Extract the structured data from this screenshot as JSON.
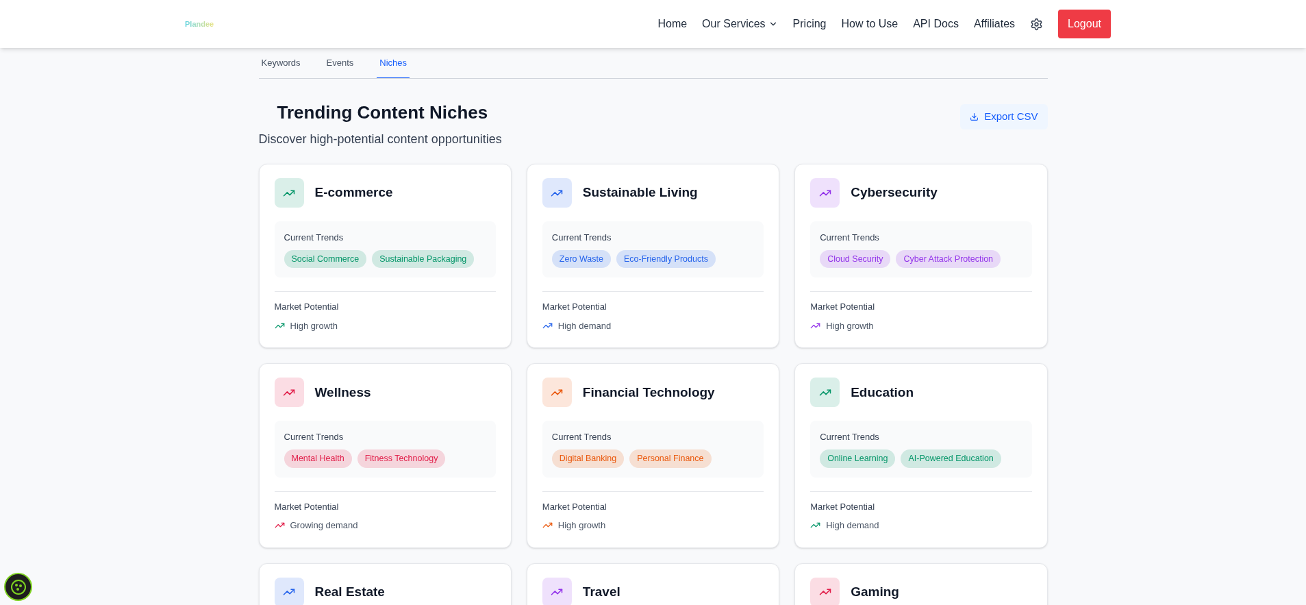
{
  "header": {
    "logo": "Plandee",
    "nav": [
      {
        "label": "Home",
        "kind": "link"
      },
      {
        "label": "Our Services",
        "kind": "dropdown"
      },
      {
        "label": "Pricing",
        "kind": "link"
      },
      {
        "label": "How to Use",
        "kind": "link"
      },
      {
        "label": "API Docs",
        "kind": "link"
      },
      {
        "label": "Affiliates",
        "kind": "link"
      }
    ],
    "logout": "Logout"
  },
  "tabs": [
    {
      "label": "Keywords",
      "selected": false
    },
    {
      "label": "Events",
      "selected": false
    },
    {
      "label": "Niches",
      "selected": true
    }
  ],
  "title": "Trending Content Niches",
  "subtitle": "Discover high-potential content opportunities",
  "export": "Export CSV",
  "niches": [
    {
      "name": "E-commerce",
      "color": "#059669",
      "trends_label": "Current Trends",
      "trends": [
        "Social Commerce",
        "Sustainable Packaging"
      ],
      "potential_label": "Market Potential",
      "potential": "High growth"
    },
    {
      "name": "Sustainable Living",
      "color": "#2563eb",
      "trends_label": "Current Trends",
      "trends": [
        "Zero Waste",
        "Eco-Friendly Products"
      ],
      "potential_label": "Market Potential",
      "potential": "High demand"
    },
    {
      "name": "Cybersecurity",
      "color": "#9333ea",
      "trends_label": "Current Trends",
      "trends": [
        "Cloud Security",
        "Cyber Attack Protection"
      ],
      "potential_label": "Market Potential",
      "potential": "High growth"
    },
    {
      "name": "Wellness",
      "color": "#e11d48",
      "trends_label": "Current Trends",
      "trends": [
        "Mental Health",
        "Fitness Technology"
      ],
      "potential_label": "Market Potential",
      "potential": "Growing demand"
    },
    {
      "name": "Financial Technology",
      "color": "#ea580c",
      "trends_label": "Current Trends",
      "trends": [
        "Digital Banking",
        "Personal Finance"
      ],
      "potential_label": "Market Potential",
      "potential": "High growth"
    },
    {
      "name": "Education",
      "color": "#059669",
      "trends_label": "Current Trends",
      "trends": [
        "Online Learning",
        "AI-Powered Education"
      ],
      "potential_label": "Market Potential",
      "potential": "High demand"
    },
    {
      "name": "Real Estate",
      "color": "#2563eb"
    },
    {
      "name": "Travel",
      "color": "#9333ea"
    },
    {
      "name": "Gaming",
      "color": "#e11d48"
    }
  ]
}
